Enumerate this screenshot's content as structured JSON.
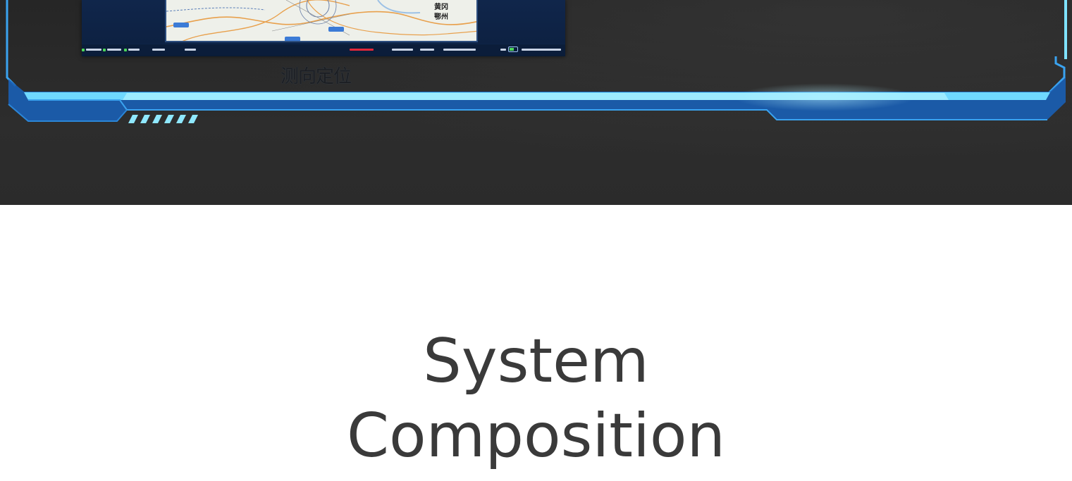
{
  "feature_caption": "测向定位",
  "section_heading": {
    "line1": "System",
    "line2": "Composition"
  },
  "map_labels": {
    "city_a": "黄冈",
    "city_b": "鄂州"
  },
  "colors": {
    "frame_blue": "#3aa3f0",
    "frame_highlight": "#7fe3ff",
    "banner_bg": "#2a2a2a",
    "heading_text": "#3a3a3a",
    "status_active": "#4cd65a",
    "status_alert": "#e3283a"
  }
}
